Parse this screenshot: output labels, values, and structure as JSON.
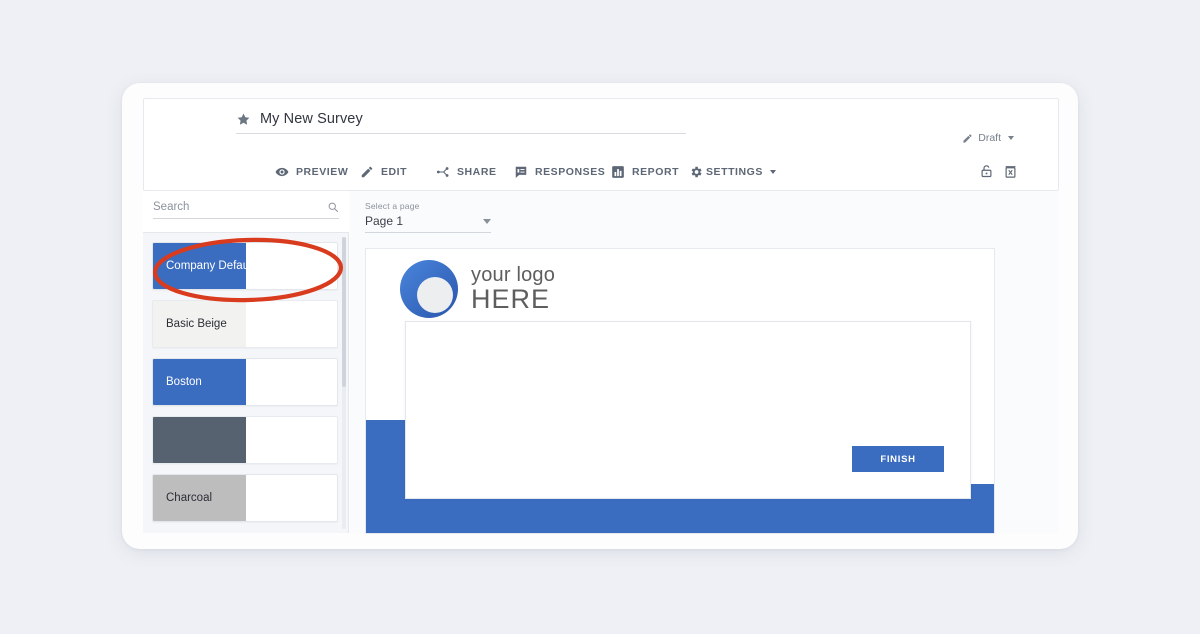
{
  "header": {
    "star_icon": "star-icon",
    "survey_title": "My New Survey",
    "status": {
      "icon": "pencil-icon",
      "label": "Draft",
      "caret": "caret-down-icon"
    }
  },
  "toolbar": {
    "items": [
      {
        "icon": "eye-icon",
        "label": "PREVIEW"
      },
      {
        "icon": "pencil-icon",
        "label": "EDIT"
      },
      {
        "icon": "share-icon",
        "label": "SHARE"
      },
      {
        "icon": "comment-icon",
        "label": "RESPONSES"
      },
      {
        "icon": "chart-bar-icon",
        "label": "REPORT"
      },
      {
        "icon": "gear-icon",
        "label": "SETTINGS"
      }
    ],
    "actions": [
      {
        "icon": "lock-icon",
        "name": "lock-button"
      },
      {
        "icon": "trash-icon",
        "name": "delete-button"
      }
    ]
  },
  "sidebar": {
    "search": {
      "placeholder": "Search",
      "value": "",
      "icon": "search-icon"
    },
    "themes": [
      {
        "name": "Company Default",
        "swatch": "#3a6cc0",
        "text_on_dark": true,
        "selected": true,
        "dim": false
      },
      {
        "name": "Basic Beige",
        "swatch": "#f2f2f0",
        "text_on_dark": false,
        "selected": false,
        "dim": true
      },
      {
        "name": "Boston",
        "swatch": "#3a6cc0",
        "text_on_dark": true,
        "selected": false,
        "dim": false
      },
      {
        "name": "",
        "swatch": "#566270",
        "text_on_dark": true,
        "selected": false,
        "dim": true
      },
      {
        "name": "Charcoal",
        "swatch": "#bdbdbd",
        "text_on_dark": false,
        "selected": false,
        "dim": false
      }
    ]
  },
  "preview": {
    "page_select": {
      "label": "Select a page",
      "value": "Page 1",
      "caret": "caret-down-icon"
    },
    "logo": {
      "icon": "logo-circle-icon",
      "line1": "your logo",
      "line2": "HERE"
    },
    "finish_label": "FINISH",
    "brand_color": "#3a6cc0"
  },
  "annotation": {
    "shape": "ellipse-highlight",
    "color": "#d93b1e",
    "target": "Company Default"
  },
  "colors": {
    "background": "#eef0f5",
    "brand_blue": "#3a6cc0",
    "slate": "#566270",
    "annotation_red": "#d93b1e",
    "toolbar_text": "#5d6775"
  }
}
